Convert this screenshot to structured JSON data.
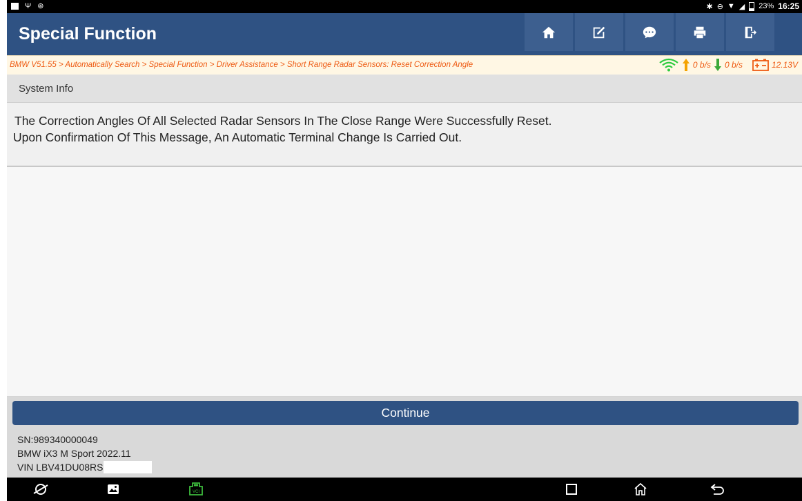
{
  "status_bar": {
    "battery_percent": "23%",
    "time": "16:25"
  },
  "header": {
    "title": "Special Function",
    "toolbar": [
      "home-icon",
      "edit-icon",
      "chat-icon",
      "print-icon",
      "exit-icon"
    ]
  },
  "breadcrumb": {
    "path": "BMW V51.55 > Automatically Search > Special Function > Driver Assistance > Short Range Radar Sensors: Reset Correction Angle",
    "upload_rate": "0 b/s",
    "download_rate": "0 b/s",
    "voltage": "12.13V"
  },
  "section": {
    "title": "System Info"
  },
  "message": {
    "line1": "The Correction Angles Of All Selected Radar Sensors In The Close Range Were Successfully Reset.",
    "line2": "Upon Confirmation Of This Message, An Automatic Terminal Change Is Carried Out."
  },
  "actions": {
    "continue_label": "Continue"
  },
  "device_info": {
    "sn": "SN:989340000049",
    "vehicle": "BMW iX3 M Sport 2022.11",
    "vin": "VIN LBV41DU08RS"
  },
  "colors": {
    "primary": "#2f5283",
    "breadcrumb_text": "#ee5a12",
    "wifi": "#2ecc40",
    "upload_arrow": "#f5a300",
    "download_arrow": "#3aa83a"
  }
}
